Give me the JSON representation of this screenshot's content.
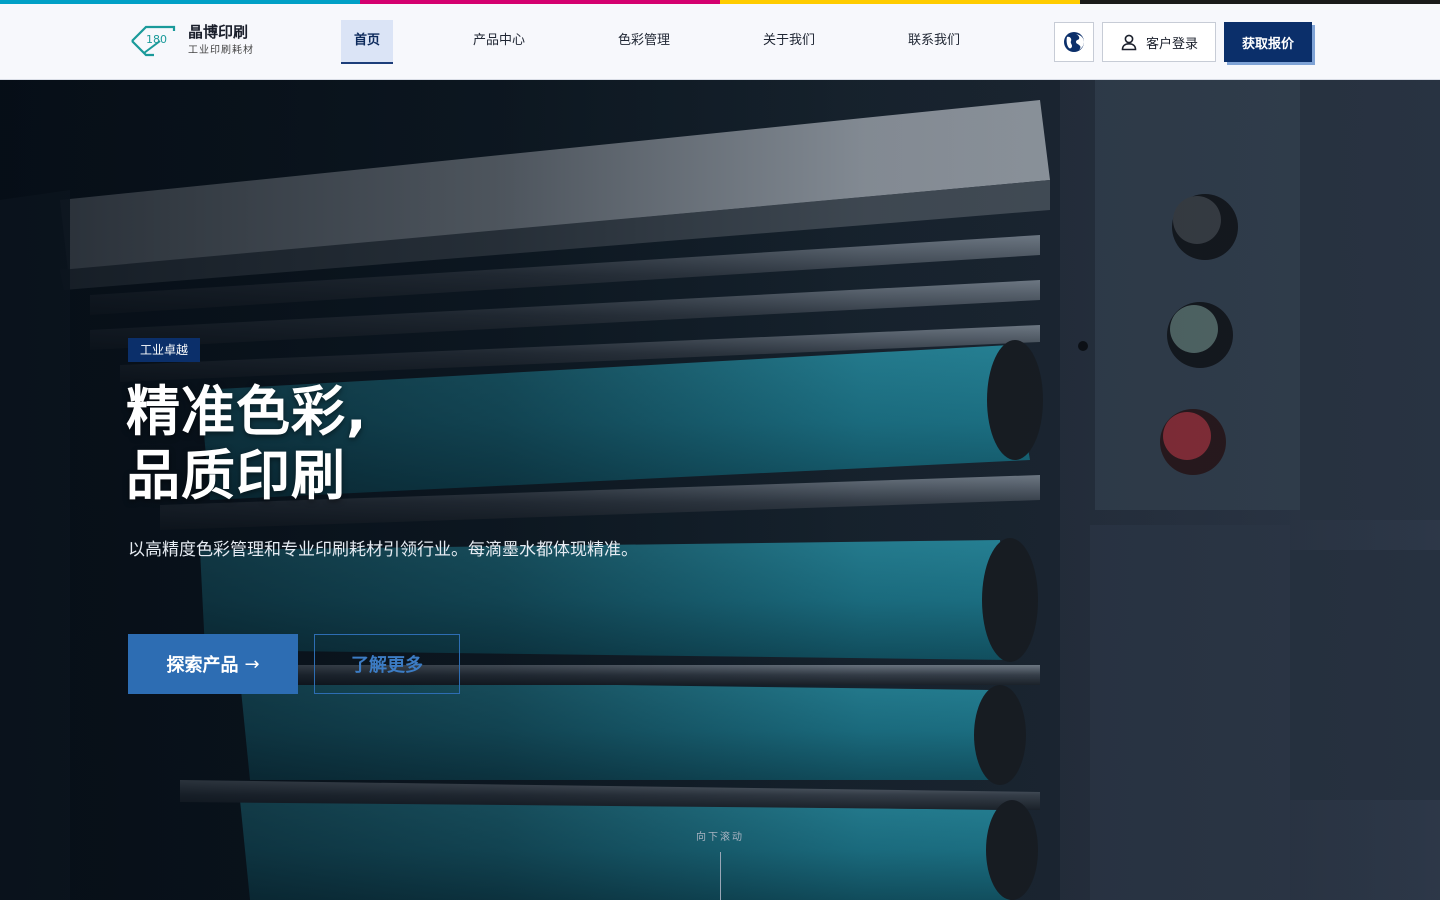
{
  "top_stripe": {
    "colors": [
      "#00a0c6",
      "#d4006f",
      "#ffcc00",
      "#1a1a1a"
    ]
  },
  "header": {
    "logo": {
      "mark_text": "180",
      "title": "晶博印刷",
      "subtitle": "工业印刷耗材"
    },
    "nav": [
      {
        "label": "首页",
        "active": true
      },
      {
        "label": "产品中心",
        "active": false
      },
      {
        "label": "色彩管理",
        "active": false
      },
      {
        "label": "关于我们",
        "active": false
      },
      {
        "label": "联系我们",
        "active": false
      }
    ],
    "language_icon": "globe-icon",
    "login_label": "客户登录",
    "login_icon": "user-icon",
    "quote_label": "获取报价"
  },
  "hero": {
    "badge": "工业卓越",
    "title_line1": "精准色彩,",
    "title_line2": "品质印刷",
    "lead": "以高精度色彩管理和专业印刷耗材引领行业。每滴墨水都体现精准。",
    "primary_cta": "探索产品",
    "primary_cta_arrow": "→",
    "secondary_cta": "了解更多",
    "scroll_hint": "向下滚动"
  },
  "colors": {
    "brand_navy": "#0b2f6a",
    "accent_blue": "#2d6db3",
    "nav_active_bg": "#dbe4f6",
    "roller_teal": "#1f7f94"
  }
}
